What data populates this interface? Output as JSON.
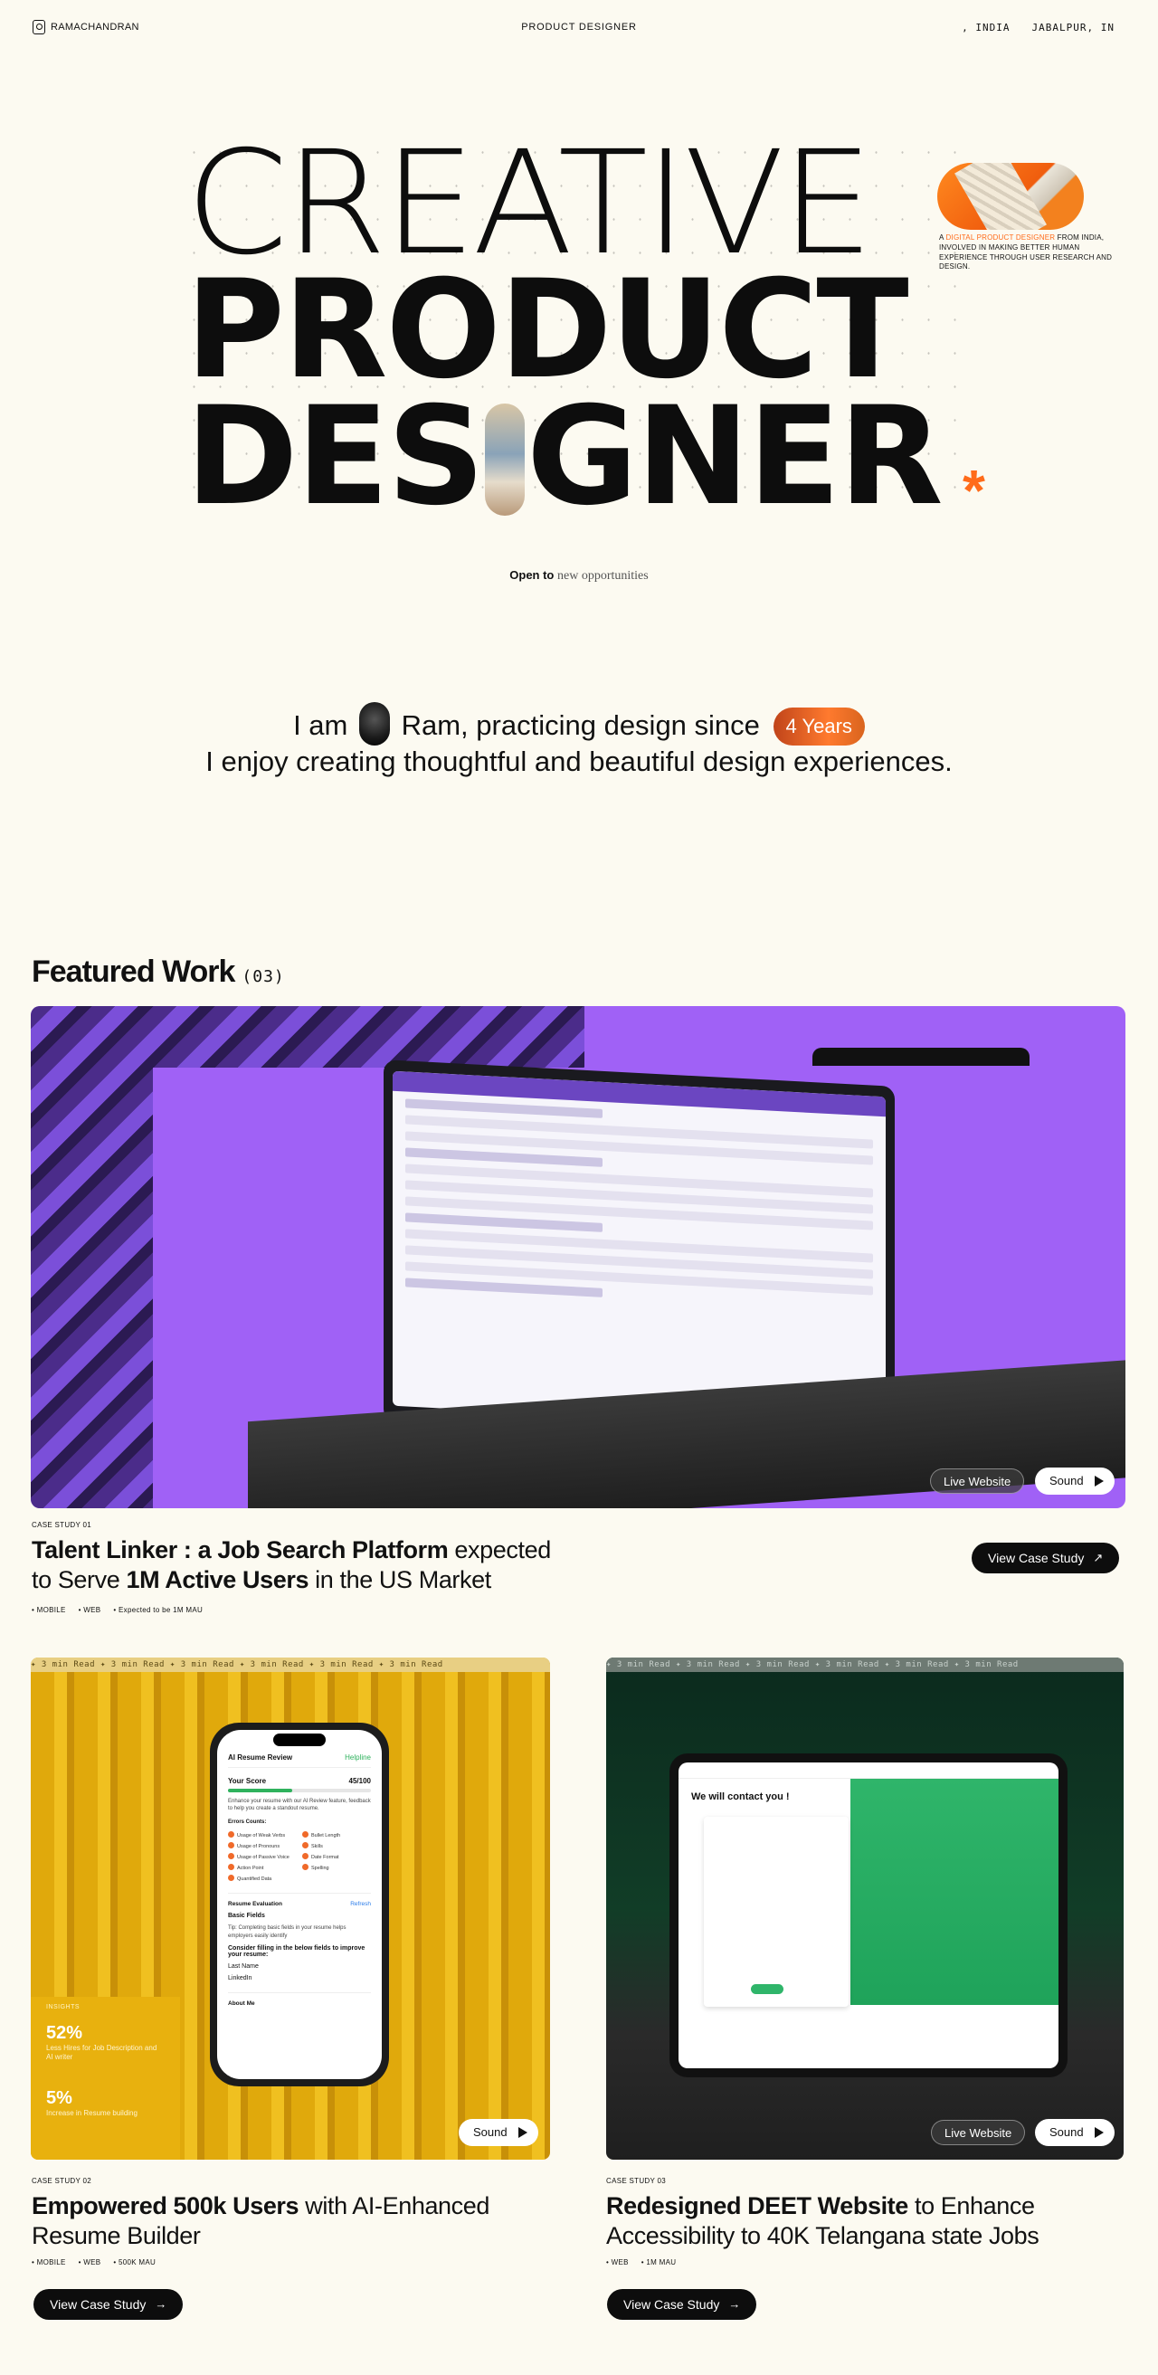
{
  "header": {
    "logo_text": "RAMACHANDRAN",
    "role": "PRODUCT DESIGNER",
    "location_country": ", INDIA",
    "location_city": "JABALPUR, IN"
  },
  "hero": {
    "line1": "CREATIVE",
    "line2": "PRODUCT",
    "line3_a": "DES",
    "line3_b": "GNER",
    "asterisk": "*",
    "desc_prefix": "A",
    "desc_accent": "DIGITAL PRODUCT DESIGNER",
    "desc_rest": "FROM INDIA, INVOLVED IN MAKING BETTER HUMAN EXPERIENCE THROUGH USER RESEARCH AND DESIGN.",
    "open_to_bold": "Open to",
    "open_to_rest": "new opportunities"
  },
  "intro": {
    "part1": "I am",
    "part2": "Ram, practicing design since",
    "years_badge": "4 Years",
    "line2": "I enjoy creating thoughtful and beautiful design experiences."
  },
  "featured": {
    "title": "Featured Work",
    "count": "(03)"
  },
  "case1": {
    "label": "CASE STUDY 01",
    "title_bold1": "Talent Linker : a Job Search Platform",
    "title_normal1": " expected",
    "title_normal2": "to Serve ",
    "title_bold2": "1M Active Users",
    "title_normal3": " in the US Market",
    "tags": [
      "• MOBILE",
      "• WEB",
      "• Expected to be 1M MAU"
    ],
    "live_label": "Live Website",
    "sound_label": "Sound",
    "cta_label": "View Case Study",
    "accent_color": "#a061f6"
  },
  "case2": {
    "ticker": "✦ 3 min Read   ✦ 3 min Read   ✦ 3 min Read   ✦ 3 min Read   ✦ 3 min Read   ✦ 3 min Read",
    "label": "CASE STUDY 02",
    "title_bold": "Empowered 500k Users",
    "title_normal": " with AI-Enhanced Resume Builder",
    "tags": [
      "• MOBILE",
      "• WEB",
      "• 500K MAU"
    ],
    "sound_label": "Sound",
    "cta_label": "View Case Study",
    "insights_heading": "INSIGHTS",
    "insight1_value": "52%",
    "insight1_desc": "Less Hires for Job Description and AI writer",
    "insight2_value": "5%",
    "insight2_desc": "Increase in Resume building",
    "phone": {
      "title": "AI Resume Review",
      "status": "Helpline",
      "score_label": "Your Score",
      "score_value": "45/100",
      "score_fraction": 0.45,
      "intro": "Enhance your resume with our AI Review feature, feedback to help you create a standout resume.",
      "errors_label": "Errors Counts:",
      "errors": [
        "Usage of Weak Verbs",
        "Bullet Length",
        "Usage of Pronouns",
        "Skills",
        "Usage of Passive Voice",
        "Date Format",
        "Action Point",
        "Spelling",
        "Quantified Data"
      ],
      "eval_label": "Resume Evaluation",
      "eval_action": "Refresh",
      "section_label": "Basic Fields",
      "tip": "Tip: Completing basic fields in your resume helps employers easily identify",
      "consider": "Consider filling in the below fields to improve your resume:",
      "fields": [
        "Last Name",
        "LinkedIn"
      ],
      "about": "About Me"
    }
  },
  "case3": {
    "ticker": "✦ 3 min Read   ✦ 3 min Read   ✦ 3 min Read   ✦ 3 min Read   ✦ 3 min Read   ✦ 3 min Read",
    "label": "CASE STUDY 03",
    "title_bold": "Redesigned DEET Website",
    "title_normal": " to Enhance Accessibility to 40K Telangana state Jobs",
    "tags": [
      "• WEB",
      "• 1M MAU"
    ],
    "live_label": "Live Website",
    "sound_label": "Sound",
    "cta_label": "View Case Study",
    "tablet_heading": "We will contact you !"
  }
}
